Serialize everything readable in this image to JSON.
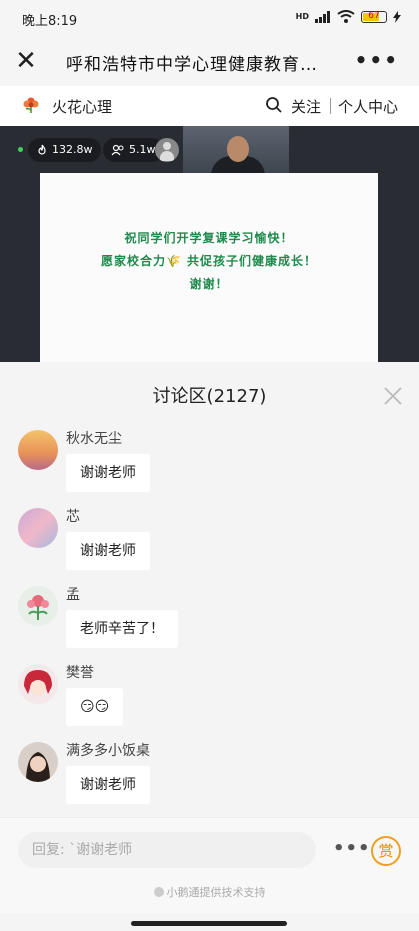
{
  "status_bar": {
    "time": "晚上8:19",
    "network": "HD",
    "battery_pct": "67",
    "battery_level": 0.67
  },
  "nav": {
    "title": "呼和浩特市中学心理健康教育…",
    "close_icon": "close-icon",
    "more_icon": "more-icon"
  },
  "brand": {
    "name": "火花心理",
    "follow_label": "关注",
    "center_label": "个人中心"
  },
  "live": {
    "heat": "132.8w",
    "viewers": "5.1w"
  },
  "slide": {
    "lines": [
      "祝同学们开学复课学习愉快！",
      "愿家校合力🌾 共促孩子们健康成长！",
      "谢谢！"
    ]
  },
  "discussion": {
    "title": "讨论区(2127)",
    "messages": [
      {
        "user": "秋水无尘",
        "text": "谢谢老师"
      },
      {
        "user": "芯",
        "text": "谢谢老师"
      },
      {
        "user": "孟",
        "text": "老师辛苦了！"
      },
      {
        "user": "樊誉",
        "text": "😏😏"
      },
      {
        "user": "满多多小饭桌",
        "text": "谢谢老师"
      }
    ]
  },
  "input": {
    "placeholder": "回复: `谢谢老师",
    "reward_label": "赏",
    "support_text": "小鹅通提供技术支持"
  },
  "colors": {
    "slide_text": "#1f8a4c",
    "live_dot": "#3cd65a",
    "reward": "#f0a020"
  }
}
